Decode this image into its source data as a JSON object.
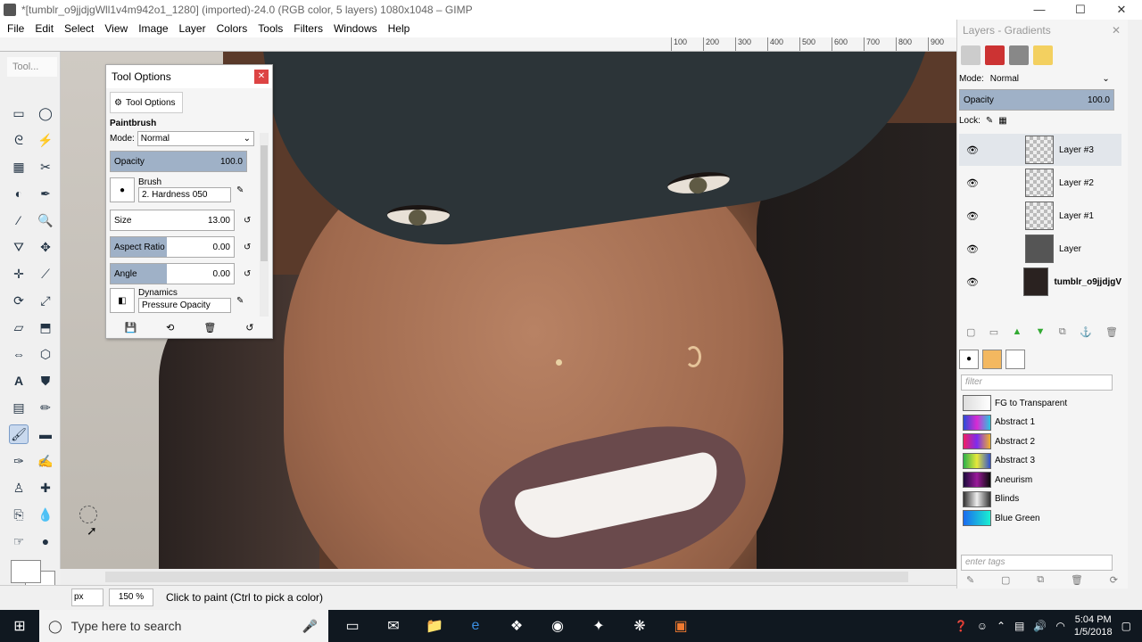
{
  "window": {
    "title": "*[tumblr_o9jjdjgWll1v4m942o1_1280] (imported)-24.0 (RGB color, 5 layers) 1080x1048 – GIMP",
    "controls": [
      "—",
      "☐",
      "✕"
    ]
  },
  "menu": [
    "File",
    "Edit",
    "Select",
    "View",
    "Image",
    "Layer",
    "Colors",
    "Tools",
    "Filters",
    "Windows",
    "Help"
  ],
  "ruler": [
    "100",
    "200",
    "300",
    "400",
    "500",
    "600",
    "700",
    "800",
    "900"
  ],
  "toolbox": {
    "title": "Tool..."
  },
  "tool_options": {
    "title": "Tool Options",
    "tab_label": "Tool Options",
    "tool_name": "Paintbrush",
    "mode_label": "Mode:",
    "mode_value": "Normal",
    "opacity_label": "Opacity",
    "opacity_value": "100.0",
    "brush_label": "Brush",
    "brush_value": "2. Hardness 050",
    "size_label": "Size",
    "size_value": "13.00",
    "aspect_label": "Aspect Ratio",
    "aspect_value": "0.00",
    "angle_label": "Angle",
    "angle_value": "0.00",
    "dynamics_label": "Dynamics",
    "dynamics_value": "Pressure Opacity"
  },
  "layers": {
    "title": "Layers - Gradients",
    "mode_label": "Mode:",
    "mode_value": "Normal",
    "opacity_label": "Opacity",
    "opacity_value": "100.0",
    "lock_label": "Lock:",
    "items": [
      {
        "name": "Layer #3"
      },
      {
        "name": "Layer #2"
      },
      {
        "name": "Layer #1"
      },
      {
        "name": "Layer"
      },
      {
        "name": "tumblr_o9jjdjgV"
      }
    ]
  },
  "gradients": {
    "filter_placeholder": "filter",
    "items": [
      {
        "name": "FG to Transparent",
        "colors": "#ddd,#fff"
      },
      {
        "name": "Abstract 1",
        "colors": "#2a4bd7,#d92ad3,#2ac7e0"
      },
      {
        "name": "Abstract 2",
        "colors": "#f01e64,#7b2cf0,#f0b22c"
      },
      {
        "name": "Abstract 3",
        "colors": "#2cb04a,#e8e83a,#3050d0"
      },
      {
        "name": "Aneurism",
        "colors": "#1a0a3a,#9a1a9a,#0a0a0a"
      },
      {
        "name": "Blinds",
        "colors": "#333,#eee,#333"
      },
      {
        "name": "Blue Green",
        "colors": "#1a6af0,#1af0d0"
      }
    ],
    "tags_placeholder": "enter tags"
  },
  "status": {
    "unit": "px",
    "zoom": "150 %",
    "message": "Click to paint (Ctrl to pick a color)"
  },
  "taskbar": {
    "search_placeholder": "Type here to search",
    "time": "5:04 PM",
    "date": "1/5/2018"
  }
}
